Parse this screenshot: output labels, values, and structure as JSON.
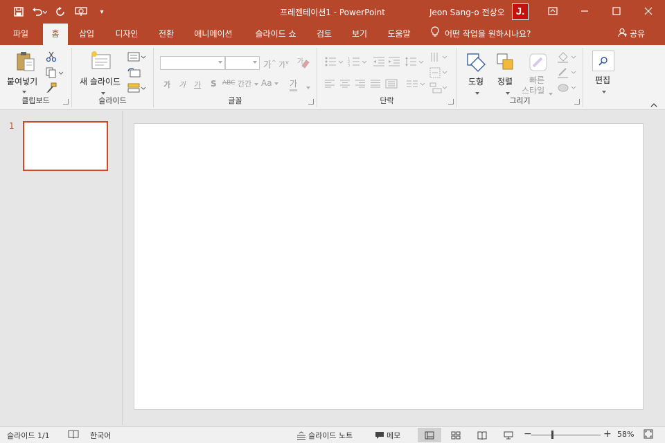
{
  "window": {
    "title": "프레젠테이션1  -  PowerPoint",
    "user_name": "Jeon Sang-o 전상오",
    "avatar_letter": "J.",
    "brand_color": "#b7472a"
  },
  "tabs": [
    {
      "label": "파일"
    },
    {
      "label": "홈",
      "active": true
    },
    {
      "label": "삽입"
    },
    {
      "label": "디자인"
    },
    {
      "label": "전환"
    },
    {
      "label": "애니메이션"
    },
    {
      "label": "슬라이드 쇼"
    },
    {
      "label": "검토"
    },
    {
      "label": "보기"
    },
    {
      "label": "도움말"
    }
  ],
  "tell_me": "어떤 작업을 원하시나요?",
  "share": "공유",
  "ribbon": {
    "clipboard": {
      "paste_label": "붙여넣기",
      "group_label": "클립보드"
    },
    "slides": {
      "new_slide_label": "새 슬라이드",
      "group_label": "슬라이드"
    },
    "font": {
      "group_label": "글꼴",
      "case_label": "Aa",
      "char_spacing_label": "간간",
      "clear_label": "가",
      "highlight_label": "가"
    },
    "paragraph": {
      "group_label": "단락"
    },
    "drawing": {
      "shapes_label": "도형",
      "arrange_label": "정렬",
      "quick_styles_label_1": "빠른",
      "quick_styles_label_2": "스타일",
      "group_label": "그리기"
    },
    "editing": {
      "label": "편집"
    }
  },
  "slides_pane": {
    "slide_number": "1"
  },
  "status_bar": {
    "slide_info": "슬라이드 1/1",
    "language": "한국어",
    "notes": "슬라이드 노트",
    "comments": "메모",
    "zoom": "58%"
  }
}
